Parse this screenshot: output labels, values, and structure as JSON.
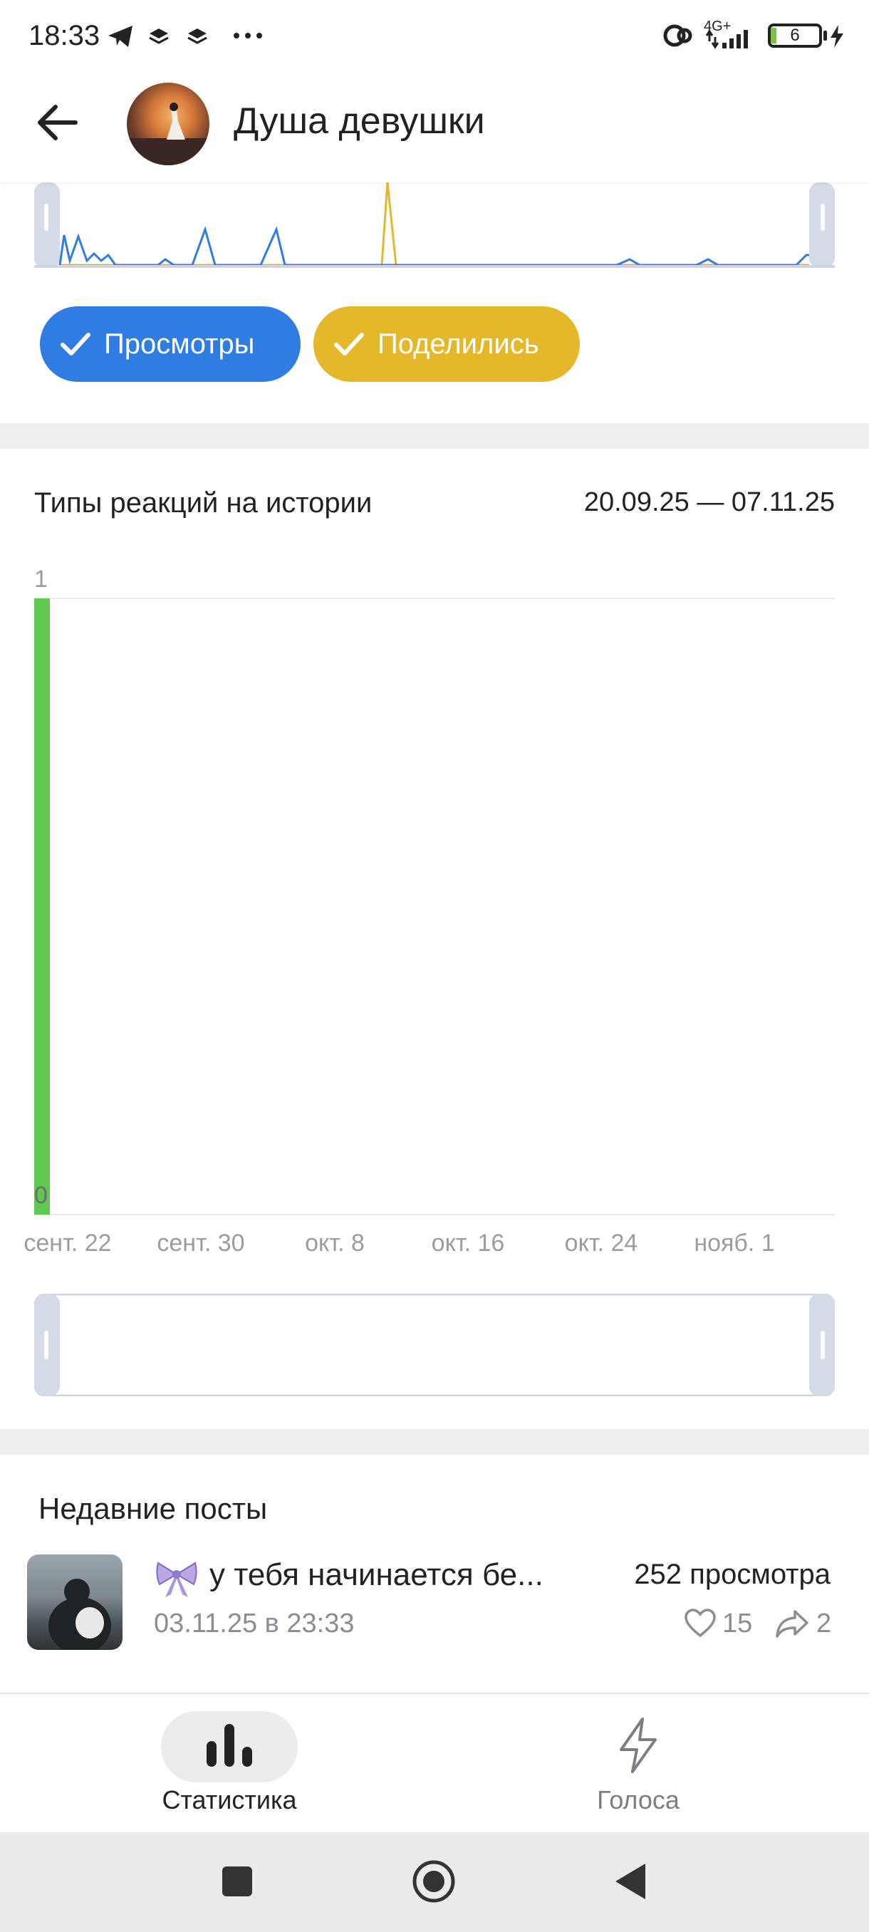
{
  "status_bar": {
    "time": "18:33",
    "network": "4G+",
    "battery": "6",
    "icons": [
      "telegram-icon",
      "layers-icon",
      "layers-icon",
      "more-dots-icon",
      "link-icon",
      "signal-icon",
      "battery-icon",
      "charging-icon"
    ]
  },
  "header": {
    "title": "Душа девушки",
    "back_icon": "arrow-left-icon"
  },
  "top_chart": {
    "toggles": [
      {
        "label": "Просмотры",
        "color": "#2f7ce2",
        "checked": true
      },
      {
        "label": "Поделились",
        "color": "#e5b72b",
        "checked": true
      }
    ]
  },
  "reactions": {
    "title": "Типы реакций на истории",
    "date_range": "20.09.25 — 07.11.25"
  },
  "chart_data": {
    "type": "bar",
    "title": "Типы реакций на истории",
    "y_ticks": [
      "1",
      "0"
    ],
    "ylim": [
      0,
      1
    ],
    "x_ticks": [
      "сент. 22",
      "сент. 30",
      "окт. 8",
      "окт. 16",
      "окт. 24",
      "нояб. 1"
    ],
    "series": [
      {
        "color": "#5fc851",
        "values": [
          {
            "x": "20.09.25",
            "y": 1
          }
        ]
      }
    ],
    "grid": true
  },
  "recent_posts": {
    "title": "Недавние посты",
    "items": [
      {
        "text": "у тебя начинается бе...",
        "date": "03.11.25 в 23:33",
        "views": "252 просмотра",
        "likes": "15",
        "shares": "2"
      }
    ]
  },
  "bottom_nav": {
    "tabs": [
      {
        "label": "Статистика",
        "icon": "bar-chart-icon",
        "active": true
      },
      {
        "label": "Голоса",
        "icon": "lightning-icon",
        "active": false
      }
    ]
  },
  "system_nav": {
    "icons": [
      "recents-square-icon",
      "home-circle-icon",
      "back-triangle-icon"
    ]
  }
}
